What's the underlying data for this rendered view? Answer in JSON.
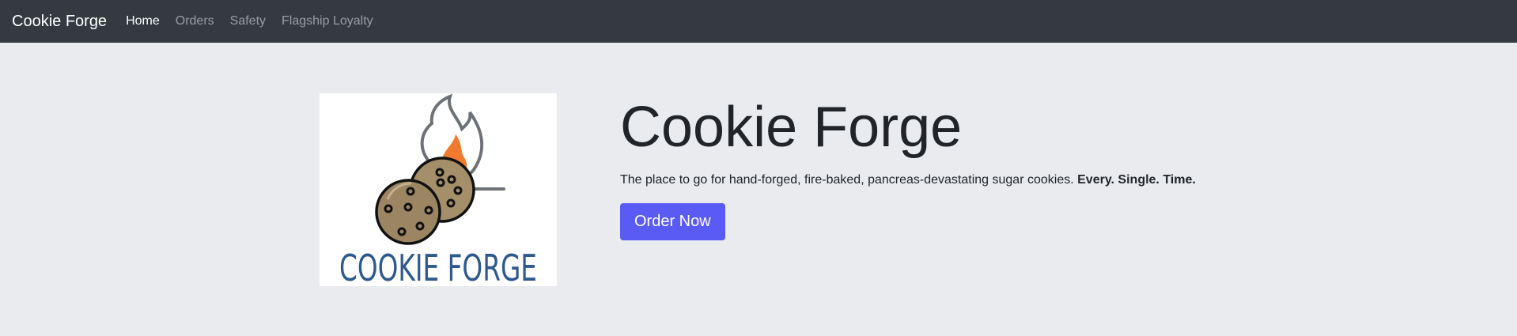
{
  "navbar": {
    "brand": "Cookie Forge",
    "items": [
      {
        "label": "Home",
        "active": true
      },
      {
        "label": "Orders",
        "active": false
      },
      {
        "label": "Safety",
        "active": false
      },
      {
        "label": "Flagship Loyalty",
        "active": false
      }
    ]
  },
  "hero": {
    "logo": {
      "text": "COOKIE FORGE",
      "icon": "cookie-flame-logo"
    },
    "title": "Cookie Forge",
    "tagline": "The place to go for hand-forged, fire-baked, pancreas-devastating sugar cookies.",
    "tagline_emphasis": "Every. Single. Time.",
    "cta_label": "Order Now"
  },
  "colors": {
    "navbar_bg": "#343a40",
    "page_bg": "#e9ebef",
    "accent": "#5a5af5",
    "logo_text": "#2f5a8f",
    "flame": "#f07a30"
  }
}
